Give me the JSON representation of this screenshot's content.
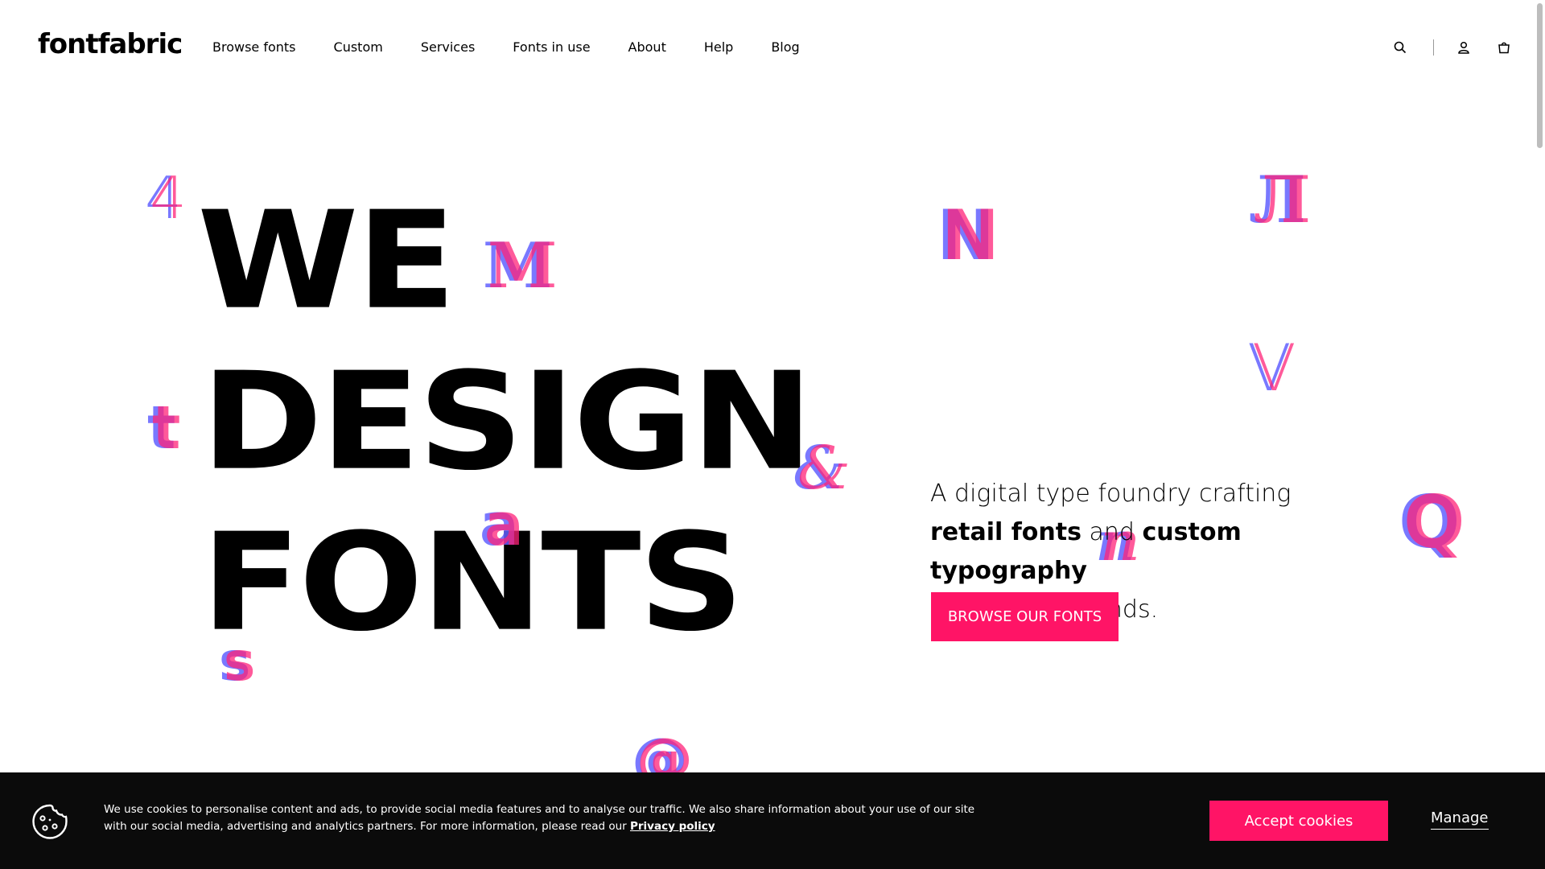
{
  "header": {
    "logo": "fontfabric",
    "nav": [
      "Browse fonts",
      "Custom",
      "Services",
      "Fonts in use",
      "About",
      "Help",
      "Blog"
    ],
    "icons": [
      "search-icon",
      "user-icon",
      "cart-icon"
    ]
  },
  "hero": {
    "line1": "WE",
    "line2": "DESIGN",
    "line3": "FONTS",
    "glyphs": [
      "4",
      "M",
      "t",
      "a",
      "s",
      "&",
      "N",
      "Л",
      "V",
      "Q",
      "n",
      "@"
    ]
  },
  "intro": {
    "text_pre": "A digital type foundry crafting",
    "bold1": "retail fonts",
    "mid": "and",
    "bold2": "custom typography",
    "text_post": "for various brands.",
    "cta": "BROWSE OUR FONTS"
  },
  "cookie_bar": {
    "text": "We use cookies to personalise content and ads, to provide social media features and to analyse our traffic. We also share information about your use of our site with our social media, advertising and analytics partners. For more information, please read our",
    "link": "Privacy policy",
    "accept": "Accept cookies",
    "manage": "Manage"
  },
  "colors": {
    "accent": "#ff1466",
    "glyph_blue": "#6160ff",
    "glyph_pink": "#ff2378",
    "cookie_bg": "#0b0b0b"
  }
}
